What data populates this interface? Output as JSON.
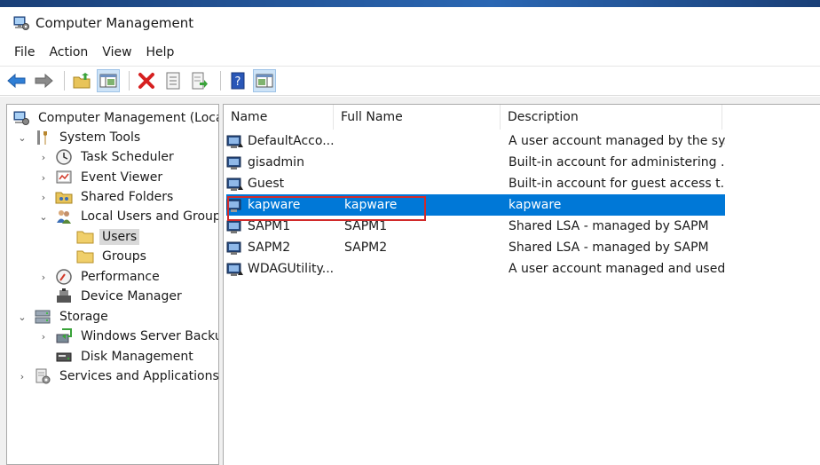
{
  "window": {
    "title": "Computer Management"
  },
  "menu": [
    "File",
    "Action",
    "View",
    "Help"
  ],
  "toolbar": {
    "buttons": [
      "back-icon",
      "forward-icon",
      "up-folder-icon",
      "show-hide-tree-icon",
      "delete-icon",
      "properties-icon",
      "export-list-icon",
      "help-icon",
      "show-action-pane-icon"
    ]
  },
  "tree": {
    "root": "Computer Management (Local)",
    "system_tools": "System Tools",
    "task_scheduler": "Task Scheduler",
    "event_viewer": "Event Viewer",
    "shared_folders": "Shared Folders",
    "local_users_groups": "Local Users and Groups",
    "users": "Users",
    "groups": "Groups",
    "performance": "Performance",
    "device_manager": "Device Manager",
    "storage": "Storage",
    "windows_server_backup": "Windows Server Backup",
    "disk_management": "Disk Management",
    "services_apps": "Services and Applications"
  },
  "list": {
    "columns": {
      "name": "Name",
      "full_name": "Full Name",
      "description": "Description"
    },
    "rows": [
      {
        "name": "DefaultAcco...",
        "full_name": "",
        "description": "A user account managed by the sy..."
      },
      {
        "name": "gisadmin",
        "full_name": "",
        "description": "Built-in account for administering ..."
      },
      {
        "name": "Guest",
        "full_name": "",
        "description": "Built-in account for guest access t..."
      },
      {
        "name": "kapware",
        "full_name": "kapware",
        "description": "kapware"
      },
      {
        "name": "SAPM1",
        "full_name": "SAPM1",
        "description": "Shared LSA - managed by SAPM"
      },
      {
        "name": "SAPM2",
        "full_name": "SAPM2",
        "description": "Shared LSA - managed by SAPM"
      },
      {
        "name": "WDAGUtility...",
        "full_name": "",
        "description": "A user account managed and used..."
      }
    ],
    "selected_index": 3
  },
  "colors": {
    "selection": "#0078d7",
    "highlight_box": "#d12a2a",
    "tree_selected": "#d9d9d9"
  }
}
